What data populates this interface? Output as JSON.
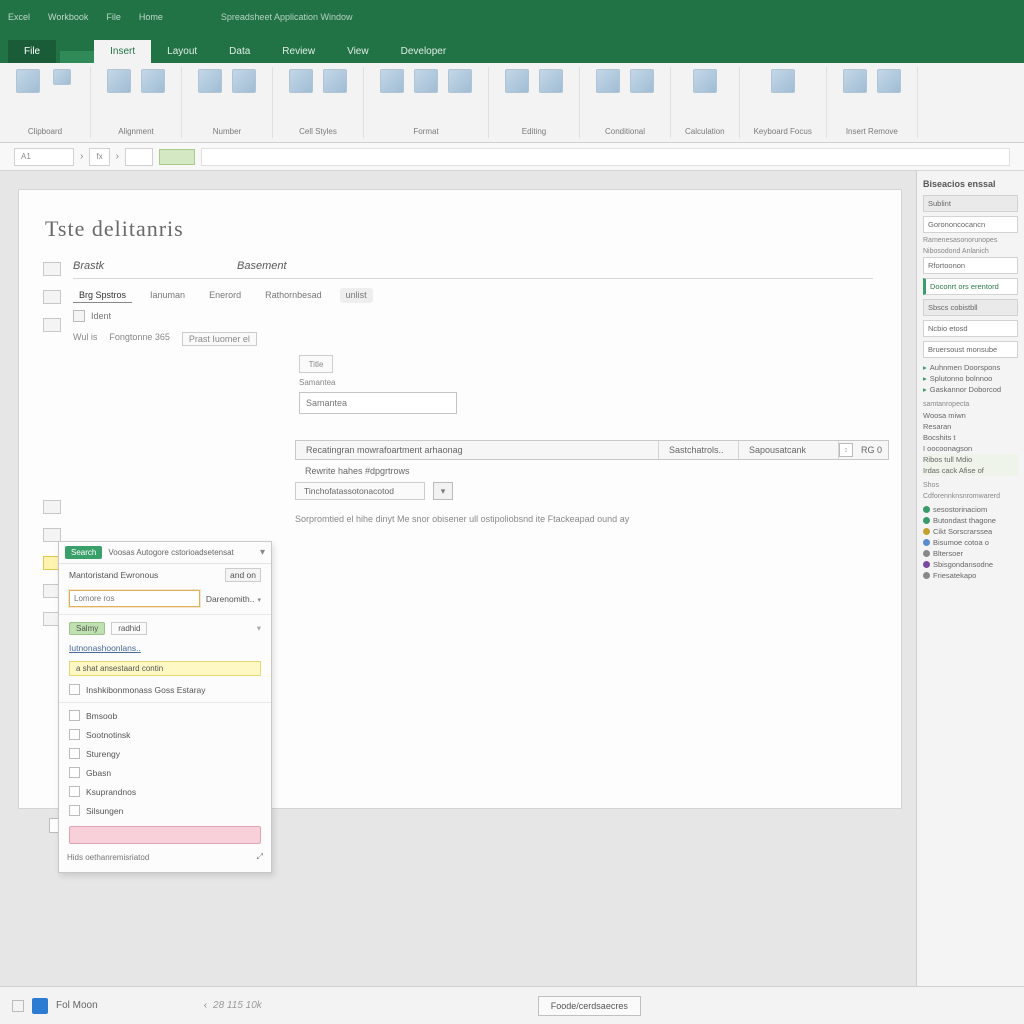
{
  "titlebar": {
    "items": [
      "Excel",
      "Workbook",
      "File",
      "Home"
    ],
    "center": "Spreadsheet Application Window"
  },
  "ribbon_tabs": {
    "file": "File",
    "items": [
      "Insert",
      "Layout",
      "Data",
      "Review",
      "View",
      "Developer"
    ]
  },
  "ribbon_groups": [
    {
      "label": "Clipboard"
    },
    {
      "label": "Alignment"
    },
    {
      "label": "Number"
    },
    {
      "label": "Cell Styles"
    },
    {
      "label": "Format"
    },
    {
      "label": "Editing"
    },
    {
      "label": "Conditional"
    },
    {
      "label": "Calculation"
    },
    {
      "label": "Keyboard Focus"
    },
    {
      "label": "Insert Remove"
    }
  ],
  "formulabar": {
    "segments": [
      "A1",
      "fx"
    ],
    "highlight": ""
  },
  "document": {
    "title": "Tste delitanris",
    "region_left": "Brastk",
    "region_right": "Basement"
  },
  "field_tabs": [
    "Brg Spstros",
    "Ianuman",
    "Enerord",
    "Rathornbesad",
    "unlist"
  ],
  "sub_bar": {
    "label": "Ident"
  },
  "sub_line": {
    "a": "Wul is",
    "b": "Fongtonne 365",
    "c": "Prast Iuomer el"
  },
  "mini_title": "Title",
  "side_input": {
    "label": "Samantea",
    "value": "Samantea"
  },
  "table_header": {
    "col1": "Recatingran mowrafoartment arhaonag",
    "col2": "Sastchatrols..",
    "col3": "Sapousatcank",
    "end_badge": "RG 0"
  },
  "table_rows": {
    "a": "Rewrite hahes #dpgrtrows",
    "b_cell": "Tinchofatassotonacotod",
    "hint": "Sorpromtied el hihe dinyt  Me snor obisener ull ostipoliobsnd  ite Ftackeapad ound ay"
  },
  "popup": {
    "badge": "Search",
    "header_text": "Voosas Autogore cstorioadsetensat",
    "row1": "Mantoristand Ewronous",
    "row1_suffix": "and on",
    "input_a": "Lomore ros",
    "input_a2": "Darenomith..",
    "sub_badge": "Salmy",
    "sub_badge2": "radhid",
    "link_a": "Iutnonashoonlans..",
    "yellow": "a shat ansestaard contin",
    "row_long": "Inshkibonmonass Goss  Estaray",
    "list": [
      "Bmsoob",
      "Sootnotinsk",
      "Sturengy",
      "Gbasn",
      "Ksuprandnos",
      "Silsungen"
    ],
    "footer": "Hids oethanremisriatod"
  },
  "side_panel": {
    "title": "Biseacios enssal",
    "heading": "Sublint",
    "boxes": [
      "Gorononcocancn",
      "Ramenesasonorunopes",
      "Nibosodond Anlanich",
      "Rfortoonon",
      "Doconrt ors erentord",
      "Sbscs cobistbll",
      "Ncbio etosd",
      "Bruersoust monsube"
    ],
    "green_items": [
      "Auhnmen Doorspons",
      "Splutonno bolnnoo",
      "Gaskannor Doborcod"
    ],
    "sub_heading": "samtanropecta",
    "small_lines": [
      "Woosa miwn",
      "Resaran",
      "Bocshits t",
      "I oocoonagson",
      "Ribos tull Mdio",
      "Irdas cack Afise of"
    ],
    "sku": "Shos",
    "sku_sub": "Cdforennknsnromwarerd",
    "dot_items": [
      {
        "color": "#3a9a6a",
        "label": "sesostorinaciom"
      },
      {
        "color": "#3a9a6a",
        "label": "Butondast thagone"
      },
      {
        "color": "#c4a030",
        "label": "Cikt Sorscrarssea"
      },
      {
        "color": "#5a8ad0",
        "label": "Bisumoe cotoa o"
      },
      {
        "color": "#888",
        "label": "Bltersoer"
      },
      {
        "color": "#7a4aa0",
        "label": "Sbisgondansodne"
      },
      {
        "color": "#888",
        "label": "Friesatekapo"
      }
    ]
  },
  "sheet_tabs": {
    "label": "",
    "tabs": [
      "",
      "",
      ""
    ]
  },
  "statusbar": {
    "left_label": "Fol Moon",
    "center": "28 115  10k",
    "button": "Foode/cerdsaecres"
  }
}
